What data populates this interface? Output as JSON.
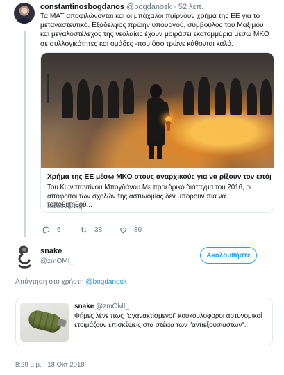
{
  "tweet": {
    "author_name": "constantinosbogdanos",
    "author_handle": "@bogdanosk",
    "time": "· 52 λεπ.",
    "text": "Τα ΜΑΤ αποφιλώνονται και οι μπάχαλοι παίρνουν χρήμα της ΕΕ για το μεταναστευτικό. Εξάδελφος πρώην υπουργού, σύμβουλος του Μαξίμου και μεγαλοστέλεχος της νεολαίας έχουν μοιράσει εκατομμύρια μέσω ΜΚΟ σε συλλογικότητες και ομάδες -που όσο τρώνε κάθονται καλά.",
    "card": {
      "title": "Χρήμα της ΕΕ μέσω ΜΚΟ στους αναρχικούς για να ρίξουν τον επόμενο",
      "description": "Του Κωνσταντίνου Μπογδάνου.Με προεδρικό διάταγμα του 2016, οι απόφοιτοι των σχολών της αστυνομίας δεν μπορούν πια να τοποθετηθού...",
      "domain": "meaculpa.gr"
    },
    "actions": {
      "reply_icon": "reply-icon",
      "replies": "6",
      "retweet_icon": "retweet-icon",
      "retweets": "38",
      "like_icon": "heart-icon",
      "likes": "80"
    }
  },
  "reply": {
    "author_name": "snake",
    "author_handle": "@zmOMI_",
    "follow_label": "Ακολουθήστε",
    "reply_to_prefix": "Απάντηση στο χρήστη",
    "reply_to_handle": "@bogdanosk",
    "quote": {
      "author_name": "snake",
      "author_handle": "@zmOMI_",
      "text": "Φήμες λένε πως \"αγανακτισμενοι\" κουκουλοφοροι αστυνομικοί ετοιμάζουν επισκέψεις στα στέκια των \"αντιεξουσιαστων\"..."
    },
    "timestamp": "8:29 μ.μ. - 18 Οκτ 2018"
  },
  "colors": {
    "accent": "#1da1f2",
    "link": "#1b95e0",
    "muted": "#657786",
    "border": "#e1e8ed"
  }
}
